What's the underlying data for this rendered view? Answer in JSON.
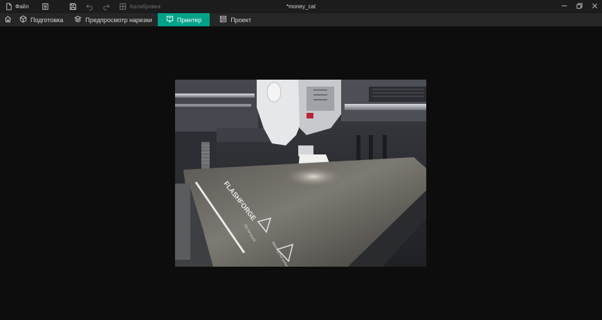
{
  "titlebar": {
    "file_label": "Файл",
    "calibration_label": "Калибровка",
    "project_title": "*money_cat",
    "icons": {
      "file": "file-icon",
      "menu": "document-list-icon",
      "save": "save-icon",
      "undo": "undo-icon",
      "redo": "redo-icon",
      "calibration": "calibration-icon",
      "minimize": "minimize-icon",
      "restore": "restore-icon",
      "close": "close-icon"
    }
  },
  "tabs": {
    "home_icon": "home-icon",
    "items": [
      {
        "label": "Подготовка",
        "icon": "cube-icon",
        "active": false
      },
      {
        "label": "Предпросмотр нарезки",
        "icon": "layers-icon",
        "active": false
      },
      {
        "label": "Принтер",
        "icon": "monitor-icon",
        "active": true
      },
      {
        "label": "Проект",
        "icon": "project-icon",
        "active": false
      }
    ]
  },
  "camera": {
    "bed_brand_text": "FLASHFORGE",
    "warning_text_1": "Do not touch",
    "warning_text_2": "Warning hot surface"
  },
  "colors": {
    "accent": "#00a38a",
    "titlebar_bg": "#1c1c1c",
    "tabbar_bg": "#262626",
    "viewport_bg": "#0d0d0d"
  }
}
